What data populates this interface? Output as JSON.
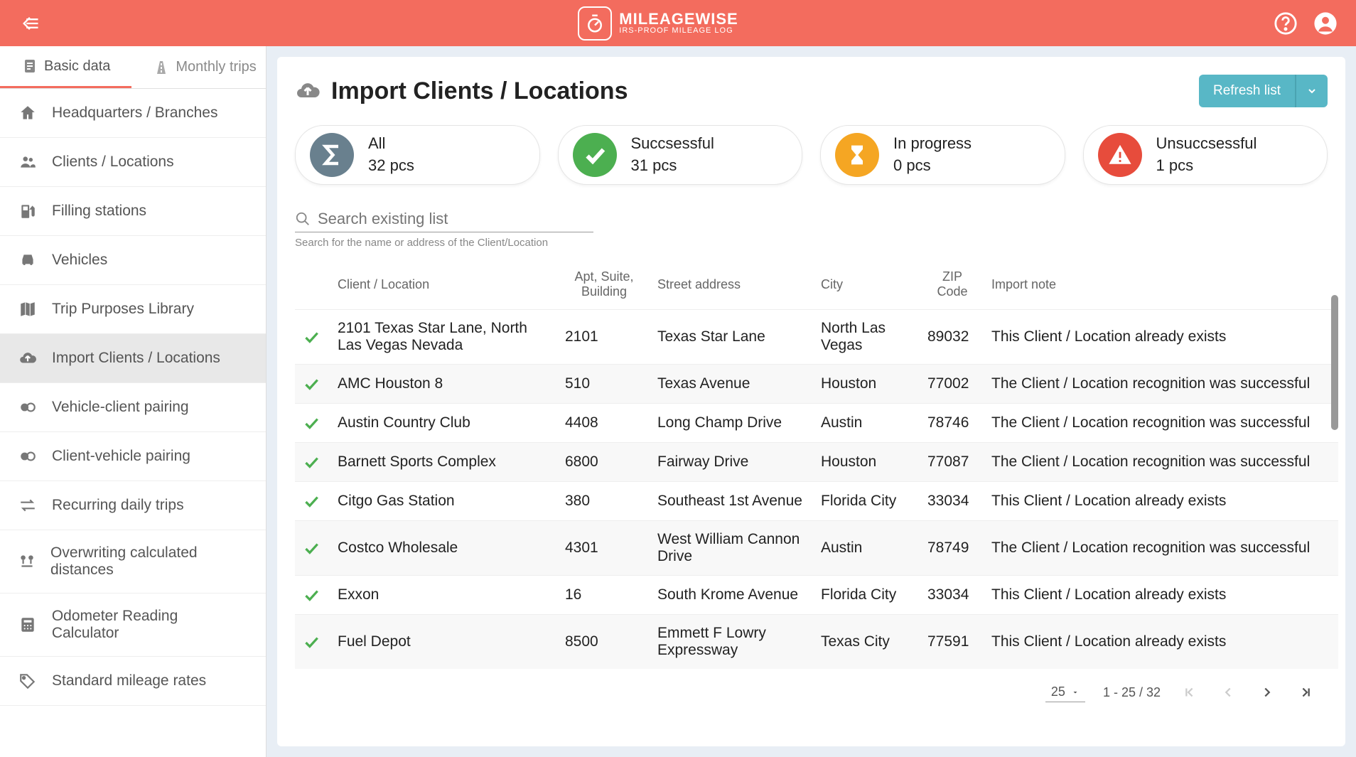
{
  "header": {
    "brand_top": "MILEAGEWISE",
    "brand_sub": "IRS-PROOF MILEAGE LOG"
  },
  "tabs": {
    "basic": "Basic data",
    "monthly": "Monthly trips"
  },
  "sidebar": {
    "items": [
      {
        "icon": "home",
        "label": "Headquarters / Branches"
      },
      {
        "icon": "people",
        "label": "Clients / Locations"
      },
      {
        "icon": "fuel",
        "label": "Filling stations"
      },
      {
        "icon": "car",
        "label": "Vehicles"
      },
      {
        "icon": "map",
        "label": "Trip Purposes Library"
      },
      {
        "icon": "upload",
        "label": "Import Clients / Locations",
        "active": true
      },
      {
        "icon": "pair",
        "label": "Vehicle-client pairing"
      },
      {
        "icon": "pair",
        "label": "Client-vehicle pairing"
      },
      {
        "icon": "repeat",
        "label": "Recurring daily trips"
      },
      {
        "icon": "pins",
        "label": "Overwriting calculated distances"
      },
      {
        "icon": "calc",
        "label": "Odometer Reading Calculator"
      },
      {
        "icon": "tag",
        "label": "Standard mileage rates"
      }
    ]
  },
  "page": {
    "title": "Import Clients / Locations",
    "refresh": "Refresh list"
  },
  "stats": {
    "all": {
      "label": "All",
      "value": "32 pcs"
    },
    "succ": {
      "label": "Succsessful",
      "value": "31 pcs"
    },
    "prog": {
      "label": "In progress",
      "value": "0 pcs"
    },
    "fail": {
      "label": "Unsuccsessful",
      "value": "1 pcs"
    }
  },
  "search": {
    "placeholder": "Search existing list",
    "hint": "Search for the name or address of the Client/Location"
  },
  "table": {
    "headers": {
      "client": "Client / Location",
      "apt": "Apt, Suite, Building",
      "street": "Street address",
      "city": "City",
      "zip": "ZIP Code",
      "note": "Import note"
    },
    "rows": [
      {
        "name": "2101 Texas Star Lane, North Las Vegas Nevada",
        "apt": "2101",
        "street": "Texas Star Lane",
        "city": "North Las Vegas",
        "zip": "89032",
        "note": "This Client / Location already exists"
      },
      {
        "name": "AMC Houston 8",
        "apt": "510",
        "street": "Texas Avenue",
        "city": "Houston",
        "zip": "77002",
        "note": "The Client / Location recognition was successful"
      },
      {
        "name": "Austin Country Club",
        "apt": "4408",
        "street": "Long Champ Drive",
        "city": "Austin",
        "zip": "78746",
        "note": "The Client / Location recognition was successful"
      },
      {
        "name": "Barnett Sports Complex",
        "apt": "6800",
        "street": "Fairway Drive",
        "city": "Houston",
        "zip": "77087",
        "note": "The Client / Location recognition was successful"
      },
      {
        "name": "Citgo Gas Station",
        "apt": "380",
        "street": "Southeast 1st Avenue",
        "city": "Florida City",
        "zip": "33034",
        "note": "This Client / Location already exists"
      },
      {
        "name": "Costco Wholesale",
        "apt": "4301",
        "street": "West William Cannon Drive",
        "city": "Austin",
        "zip": "78749",
        "note": "The Client / Location recognition was successful"
      },
      {
        "name": "Exxon",
        "apt": "16",
        "street": "South Krome Avenue",
        "city": "Florida City",
        "zip": "33034",
        "note": "This Client / Location already exists"
      },
      {
        "name": "Fuel Depot",
        "apt": "8500",
        "street": "Emmett F Lowry Expressway",
        "city": "Texas City",
        "zip": "77591",
        "note": "This Client / Location already exists"
      }
    ]
  },
  "pager": {
    "size": "25",
    "range": "1 - 25 / 32"
  }
}
